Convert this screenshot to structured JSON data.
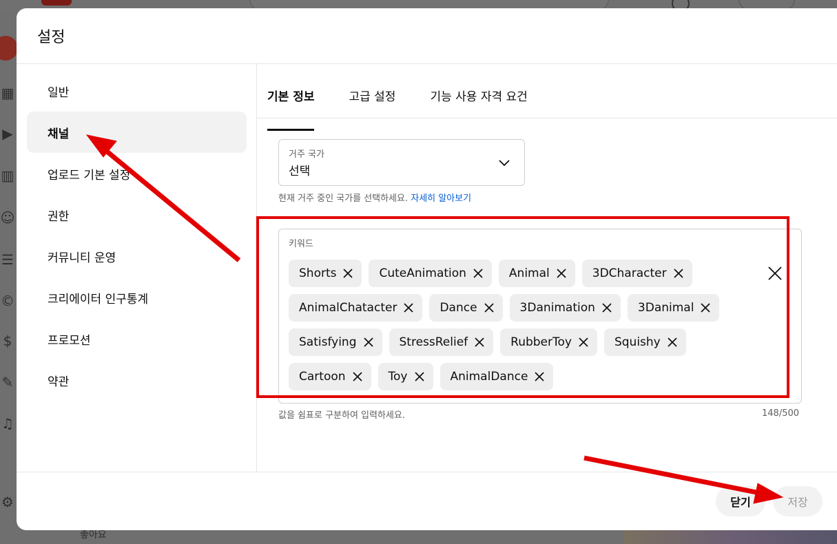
{
  "background": {
    "bottom_text": "좋아요",
    "sidebar_icons": [
      "dashboard-icon",
      "content-icon",
      "analytics-icon",
      "community-icon",
      "subtitles-icon",
      "copyright-icon",
      "earn-icon",
      "customization-icon",
      "audio-library-icon",
      "settings-icon"
    ]
  },
  "dialog": {
    "title": "설정",
    "nav": [
      {
        "label": "일반",
        "active": false
      },
      {
        "label": "채널",
        "active": true
      },
      {
        "label": "업로드 기본 설정",
        "active": false
      },
      {
        "label": "권한",
        "active": false
      },
      {
        "label": "커뮤니티 운영",
        "active": false
      },
      {
        "label": "크리에이터 인구통계",
        "active": false
      },
      {
        "label": "프로모션",
        "active": false
      },
      {
        "label": "약관",
        "active": false
      }
    ],
    "tabs": [
      {
        "label": "기본 정보",
        "active": true
      },
      {
        "label": "고급 설정",
        "active": false
      },
      {
        "label": "기능 사용 자격 요건",
        "active": false
      }
    ],
    "country": {
      "label": "거주 국가",
      "value": "선택",
      "helper": "현재 거주 중인 국가를 선택하세요.",
      "link": "자세히 알아보기"
    },
    "keywords": {
      "label": "키워드",
      "chips": [
        "Shorts",
        "CuteAnimation",
        "Animal",
        "3DCharacter",
        "AnimalChatacter",
        "Dance",
        "3Danimation",
        "3Danimal",
        "Satisfying",
        "StressRelief",
        "RubberToy",
        "Squishy",
        "Cartoon",
        "Toy",
        "AnimalDance"
      ],
      "helper": "값을 쉼표로 구분하여 입력하세요.",
      "count": "148/500"
    },
    "buttons": {
      "close": "닫기",
      "save": "저장"
    }
  },
  "colors": {
    "annotation": "#e30000",
    "link": "#065fd4"
  }
}
